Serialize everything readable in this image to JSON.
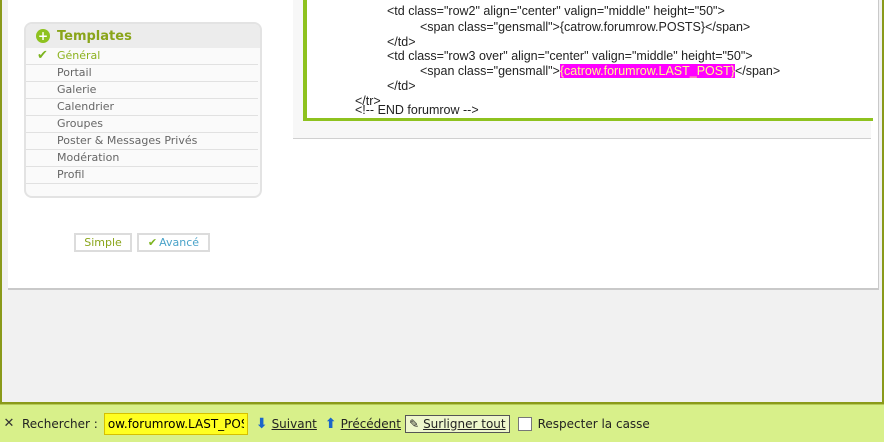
{
  "sidebar": {
    "title": "Templates",
    "items": [
      {
        "label": "Général",
        "active": true
      },
      {
        "label": "Portail"
      },
      {
        "label": "Galerie"
      },
      {
        "label": "Calendrier"
      },
      {
        "label": "Groupes"
      },
      {
        "label": "Poster & Messages Privés"
      },
      {
        "label": "Modération"
      },
      {
        "label": "Profil"
      }
    ]
  },
  "mode_buttons": {
    "simple": "Simple",
    "avance": "Avancé"
  },
  "code": {
    "lines": [
      "<td class=\"row2\" align=\"center\" valign=\"middle\" height=\"50\">",
      "<span class=\"gensmall\">{catrow.forumrow.POSTS}</span>",
      "</td>",
      "<td class=\"row3 over\" align=\"center\" valign=\"middle\" height=\"50\">",
      "<span class=\"gensmall\">",
      "{catrow.forumrow.LAST_POST}",
      "</span>",
      "</td>",
      "</tr>",
      "<!-- END forumrow -->"
    ]
  },
  "findbar": {
    "label": "Rechercher :",
    "value": "ow.forumrow.LAST_POST}",
    "next": "Suivant",
    "prev": "Précédent",
    "highlight": "Surligner tout",
    "match_case": "Respecter la casse"
  },
  "colors": {
    "accent": "#8ec21f",
    "highlight": "#ff00ff",
    "findbar": "#d8f08a"
  }
}
